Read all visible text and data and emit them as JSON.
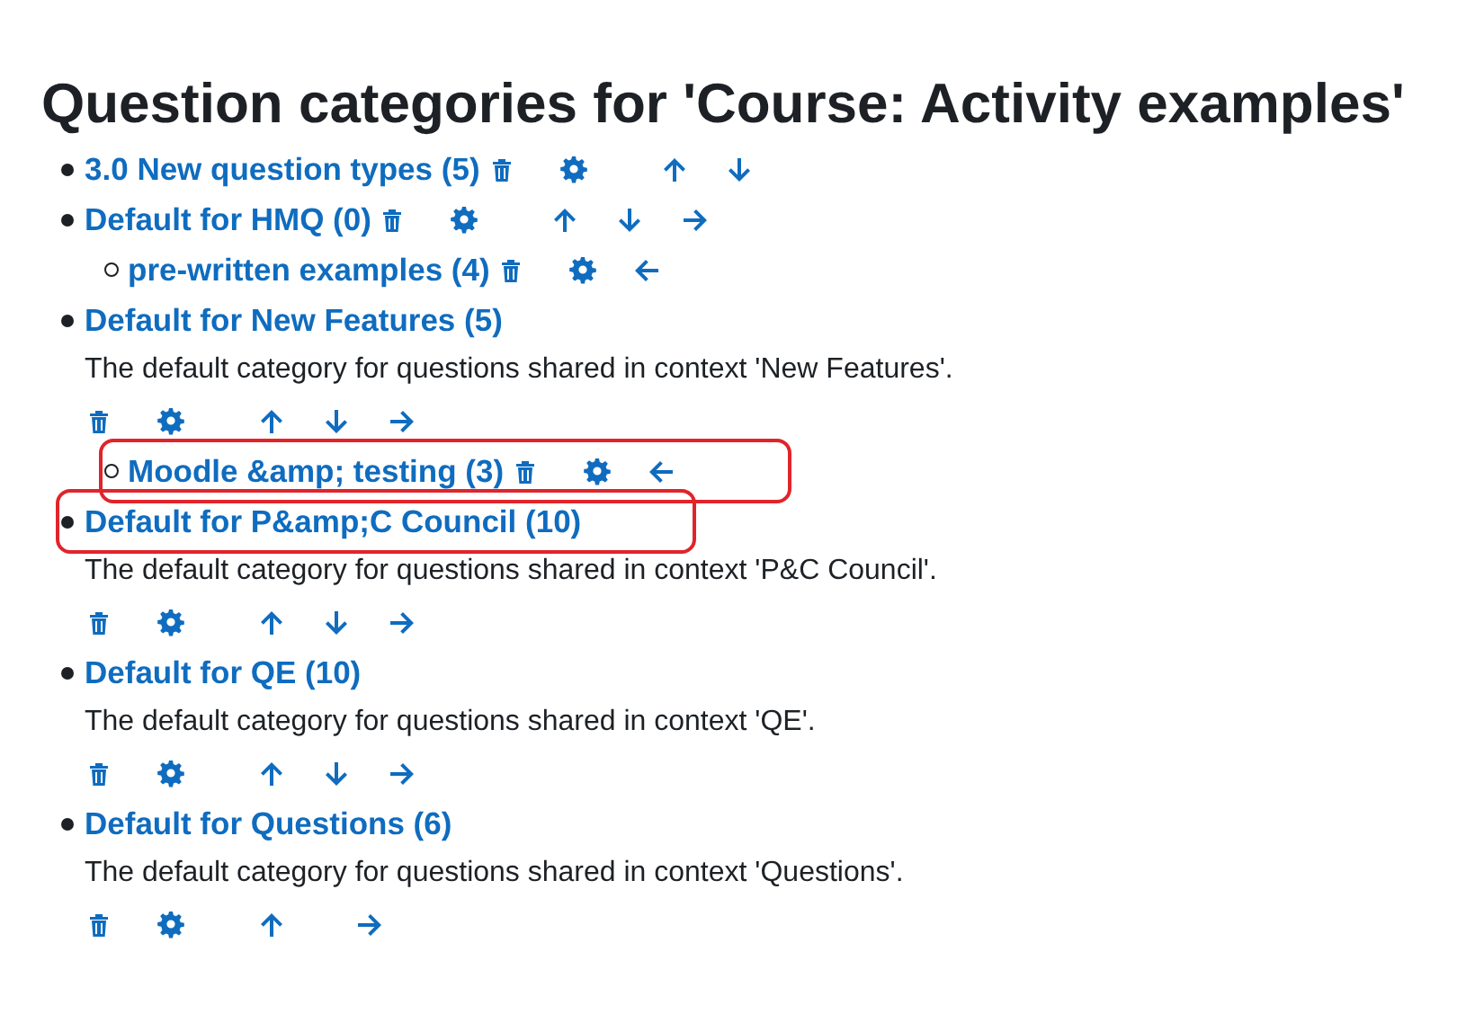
{
  "heading": "Question categories for 'Course: Activity examples'",
  "categories": [
    {
      "title": "3.0 New question types (5)",
      "highlighted": false,
      "actions": [
        {
          "kind": "delete"
        },
        {
          "kind": "edit"
        },
        {
          "kind": "up"
        },
        {
          "kind": "down"
        }
      ]
    },
    {
      "title": "Default for HMQ (0)",
      "highlighted": false,
      "actions": [
        {
          "kind": "delete"
        },
        {
          "kind": "edit"
        },
        {
          "kind": "up"
        },
        {
          "kind": "down"
        },
        {
          "kind": "right"
        }
      ],
      "children": [
        {
          "title": "pre-written examples (4)",
          "highlighted": false,
          "actions": [
            {
              "kind": "delete"
            },
            {
              "kind": "edit"
            },
            {
              "kind": "left"
            }
          ]
        }
      ]
    },
    {
      "title": "Default for New Features (5)",
      "highlighted": false,
      "description": "The default category for questions shared in context 'New Features'.",
      "actions": [
        {
          "kind": "delete"
        },
        {
          "kind": "edit"
        },
        {
          "kind": "up"
        },
        {
          "kind": "down"
        },
        {
          "kind": "right"
        }
      ],
      "children": [
        {
          "title": "Moodle &amp; testing (3)",
          "highlighted": true,
          "actions": [
            {
              "kind": "delete"
            },
            {
              "kind": "edit"
            },
            {
              "kind": "left"
            }
          ]
        }
      ]
    },
    {
      "title": "Default for P&amp;C Council (10)",
      "highlighted": true,
      "description": "The default category for questions shared in context 'P&C Council'.",
      "actions": [
        {
          "kind": "delete"
        },
        {
          "kind": "edit"
        },
        {
          "kind": "up"
        },
        {
          "kind": "down"
        },
        {
          "kind": "right"
        }
      ]
    },
    {
      "title": "Default for QE (10)",
      "highlighted": false,
      "description": "The default category for questions shared in context 'QE'.",
      "actions": [
        {
          "kind": "delete"
        },
        {
          "kind": "edit"
        },
        {
          "kind": "up"
        },
        {
          "kind": "down"
        },
        {
          "kind": "right"
        }
      ]
    },
    {
      "title": "Default for Questions (6)",
      "highlighted": false,
      "description": "The default category for questions shared in context 'Questions'.",
      "actions": [
        {
          "kind": "delete"
        },
        {
          "kind": "edit"
        },
        {
          "kind": "up"
        },
        {
          "kind": "right"
        }
      ]
    }
  ]
}
